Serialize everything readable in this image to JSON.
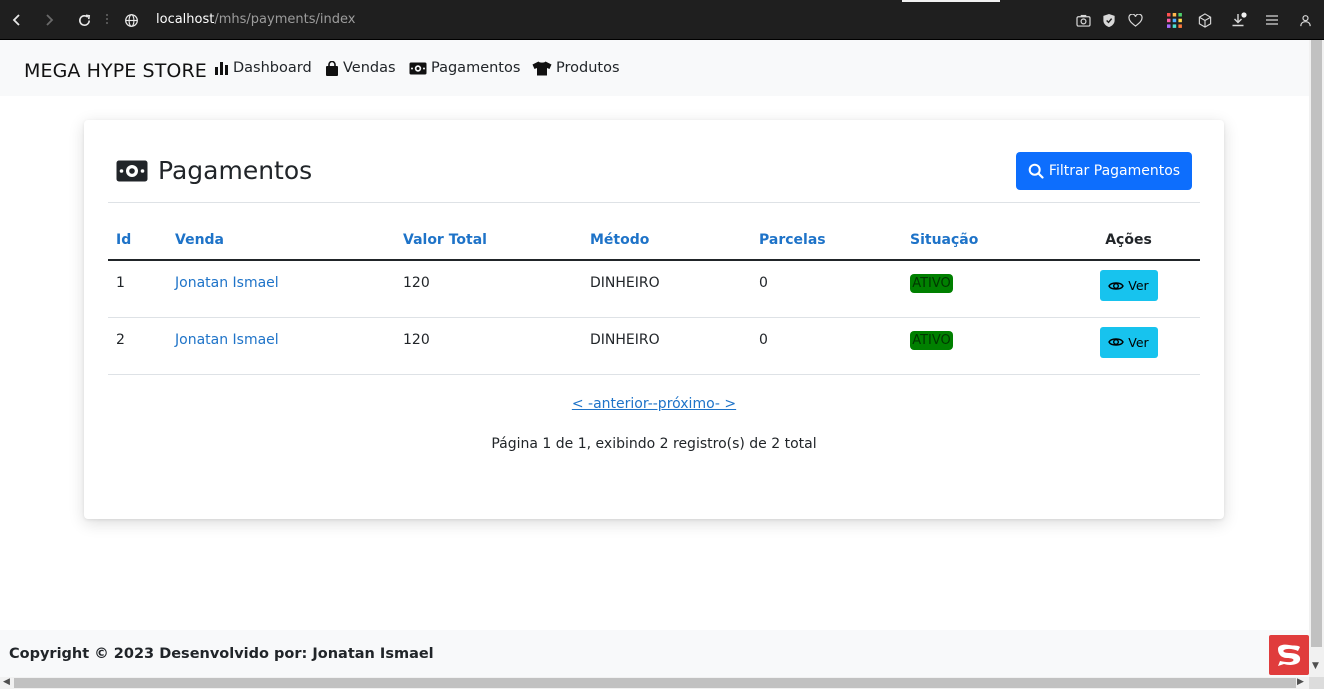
{
  "browser": {
    "url_host": "localhost",
    "url_path": "/mhs/payments/index"
  },
  "navbar": {
    "brand": "MEGA HYPE STORE",
    "items": [
      {
        "label": "Dashboard",
        "icon": "chart-bar-icon"
      },
      {
        "label": "Vendas",
        "icon": "shopping-bag-icon"
      },
      {
        "label": "Pagamentos",
        "icon": "money-bill-icon"
      },
      {
        "label": "Produtos",
        "icon": "shirt-icon"
      }
    ]
  },
  "page": {
    "title": "Pagamentos",
    "filter_button": "Filtrar Pagamentos"
  },
  "table": {
    "headers": [
      "Id",
      "Venda",
      "Valor Total",
      "Método",
      "Parcelas",
      "Situação",
      "Ações"
    ],
    "rows": [
      {
        "id": "1",
        "venda": "Jonatan Ismael",
        "valor_total": "120",
        "metodo": "DINHEIRO",
        "parcelas": "0",
        "situacao": "ATIVO",
        "acao": "Ver"
      },
      {
        "id": "2",
        "venda": "Jonatan Ismael",
        "valor_total": "120",
        "metodo": "DINHEIRO",
        "parcelas": "0",
        "situacao": "ATIVO",
        "acao": "Ver"
      }
    ]
  },
  "pagination": {
    "link_text": "< -anterior--próximo- >",
    "summary": "Página 1 de 1, exibindo 2 registro(s) de 2 total"
  },
  "footer": {
    "copyright": "Copyright © 2023 Desenvolvido por: Jonatan Ismael"
  },
  "colors": {
    "primary": "#0d6efd",
    "link": "#1e73c8",
    "info": "#17c3ee",
    "status_active": "#008000"
  }
}
